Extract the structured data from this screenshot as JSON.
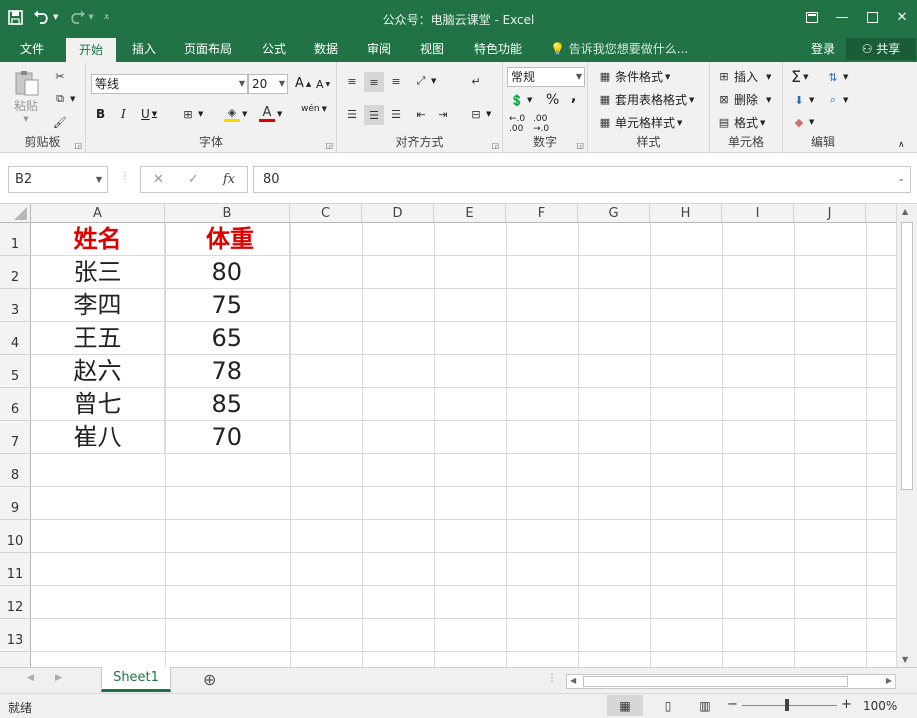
{
  "window": {
    "title": "公众号：电脑云课堂 - Excel",
    "accent": "#217346"
  },
  "qat": {
    "save_icon": "save-icon",
    "undo_icon": "undo-icon",
    "redo_icon": "redo-icon",
    "customize_icon": "customize-qat-icon"
  },
  "tabs": [
    "文件",
    "开始",
    "插入",
    "页面布局",
    "公式",
    "数据",
    "审阅",
    "视图",
    "特色功能"
  ],
  "active_tab": "开始",
  "tell_me": "告诉我您想要做什么...",
  "account": {
    "login": "登录",
    "share": "共享"
  },
  "ribbon": {
    "clipboard": {
      "label": "剪贴板",
      "paste": "粘贴"
    },
    "font": {
      "label": "字体",
      "name": "等线",
      "size": "20",
      "bold": "B",
      "italic": "I",
      "underline": "U",
      "grow": "A",
      "shrink": "A",
      "font_color": "A",
      "phonetic": "wén"
    },
    "alignment": {
      "label": "对齐方式"
    },
    "number": {
      "label": "数字",
      "format": "常规",
      "percent": "%",
      "comma": ","
    },
    "styles": {
      "label": "样式",
      "conditional": "条件格式",
      "table": "套用表格格式",
      "cell_styles": "单元格样式"
    },
    "cells": {
      "label": "单元格",
      "insert": "插入",
      "delete": "删除",
      "format": "格式"
    },
    "editing": {
      "label": "编辑",
      "sum": "Σ"
    }
  },
  "formula_bar": {
    "name_box": "B2",
    "value": "80",
    "fx": "fx"
  },
  "columns": [
    "A",
    "B",
    "C",
    "D",
    "E",
    "F",
    "G",
    "H",
    "I",
    "J"
  ],
  "rows": [
    "1",
    "2",
    "3",
    "4",
    "5",
    "6",
    "7",
    "8",
    "9",
    "10",
    "11",
    "12",
    "13"
  ],
  "table": {
    "header": [
      "姓名",
      "体重"
    ],
    "header_color": "#e00000",
    "records": [
      [
        "张三",
        "80"
      ],
      [
        "李四",
        "75"
      ],
      [
        "王五",
        "65"
      ],
      [
        "赵六",
        "78"
      ],
      [
        "曾七",
        "85"
      ],
      [
        "崔八",
        "70"
      ]
    ]
  },
  "sheet": {
    "tab": "Sheet1",
    "add": "⊕"
  },
  "status": {
    "ready": "就绪",
    "zoom": "100%",
    "zoom_minus": "−",
    "zoom_plus": "+"
  }
}
